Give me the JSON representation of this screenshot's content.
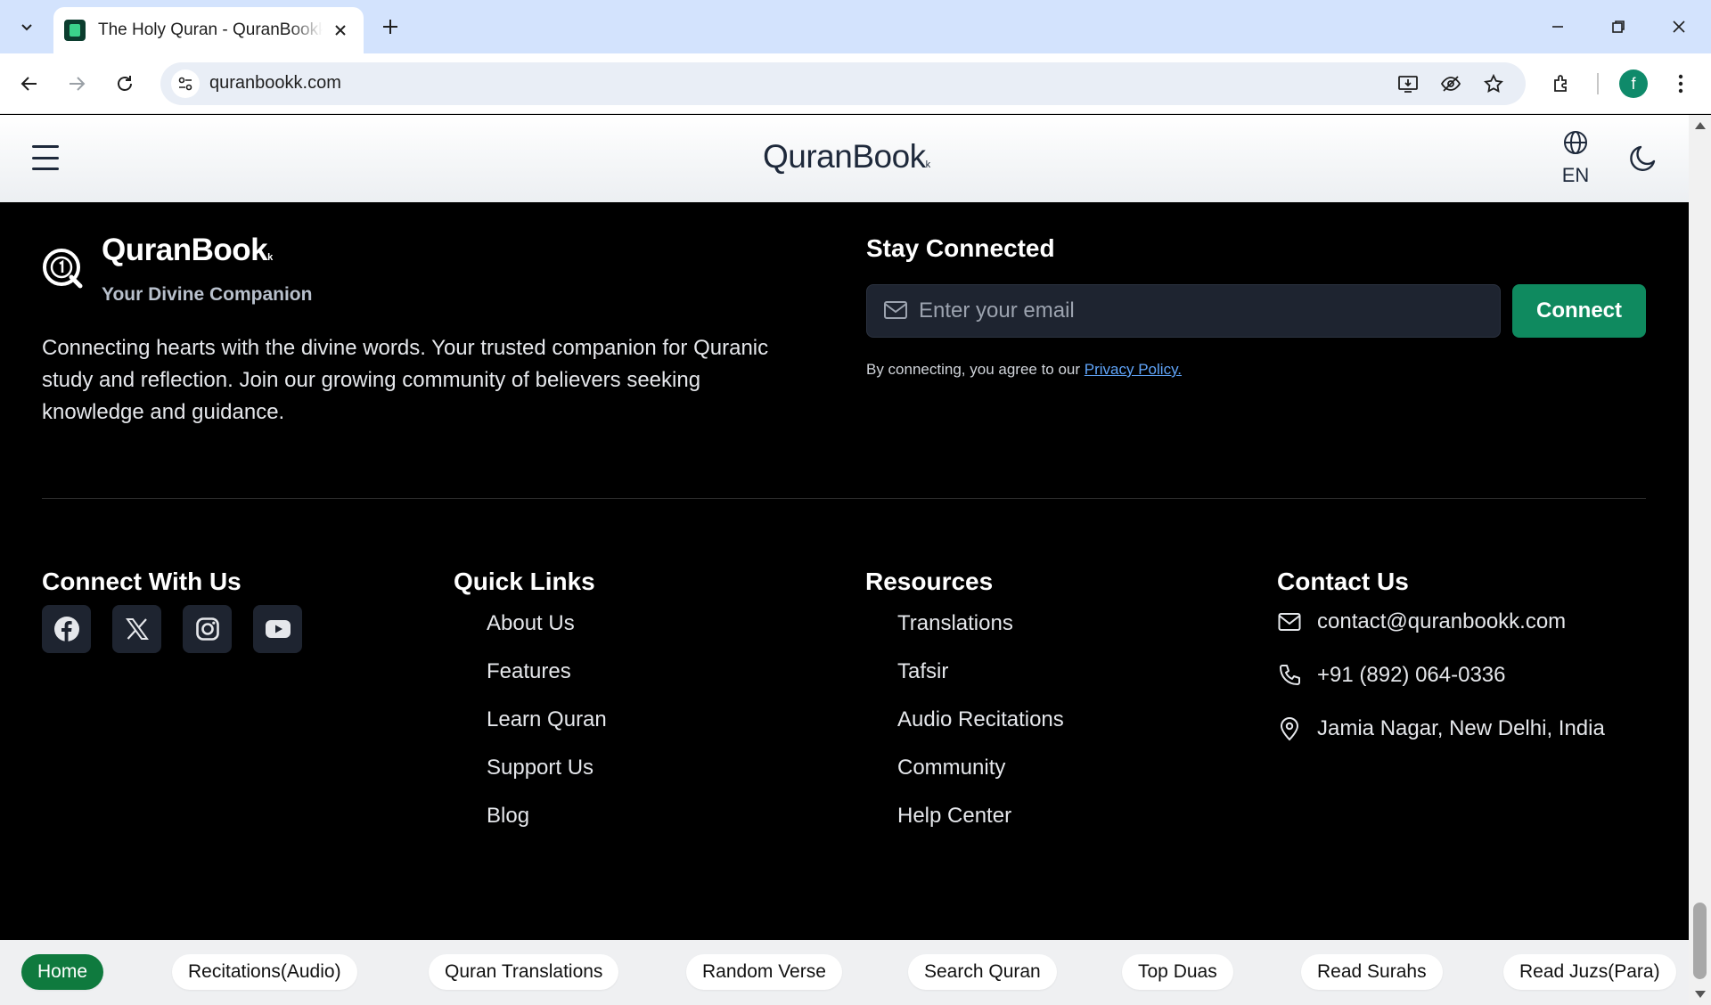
{
  "browser": {
    "tab_title": "The Holy Quran - QuranBookk.com",
    "url": "quranbookk.com",
    "profile_initial": "f"
  },
  "header": {
    "brand": "QuranBook",
    "brand_suffix": "k",
    "language": "EN"
  },
  "footer": {
    "brand": "QuranBook",
    "brand_suffix": "k",
    "tagline": "Your Divine Companion",
    "about": "Connecting hearts with the divine words. Your trusted companion for Quranic study and reflection. Join our growing community of believers seeking knowledge and guidance.",
    "stay_connected": {
      "title": "Stay Connected",
      "email_placeholder": "Enter your email",
      "button": "Connect",
      "agree_text": "By connecting, you agree to our ",
      "privacy_link": "Privacy Policy."
    },
    "connect_with_us": {
      "title": "Connect With Us",
      "icons": [
        "facebook-icon",
        "x-icon",
        "instagram-icon",
        "youtube-icon"
      ]
    },
    "quick_links": {
      "title": "Quick Links",
      "items": [
        "About Us",
        "Features",
        "Learn Quran",
        "Support Us",
        "Blog"
      ]
    },
    "resources": {
      "title": "Resources",
      "items": [
        "Translations",
        "Tafsir",
        "Audio Recitations",
        "Community",
        "Help Center"
      ]
    },
    "contact": {
      "title": "Contact Us",
      "email": "contact@quranbookk.com",
      "phone": "+91 (892) 064-0336",
      "address": "Jamia Nagar, New Delhi, India"
    }
  },
  "bottom_nav": {
    "items": [
      "Home",
      "Recitations(Audio)",
      "Quran Translations",
      "Random Verse",
      "Search Quran",
      "Top Duas",
      "Read Surahs",
      "Read Juzs(Para)"
    ],
    "active": "Home"
  },
  "colors": {
    "accent": "#0f8a5f",
    "active_nav": "#0f7a3e",
    "footer_bg": "#000000"
  }
}
